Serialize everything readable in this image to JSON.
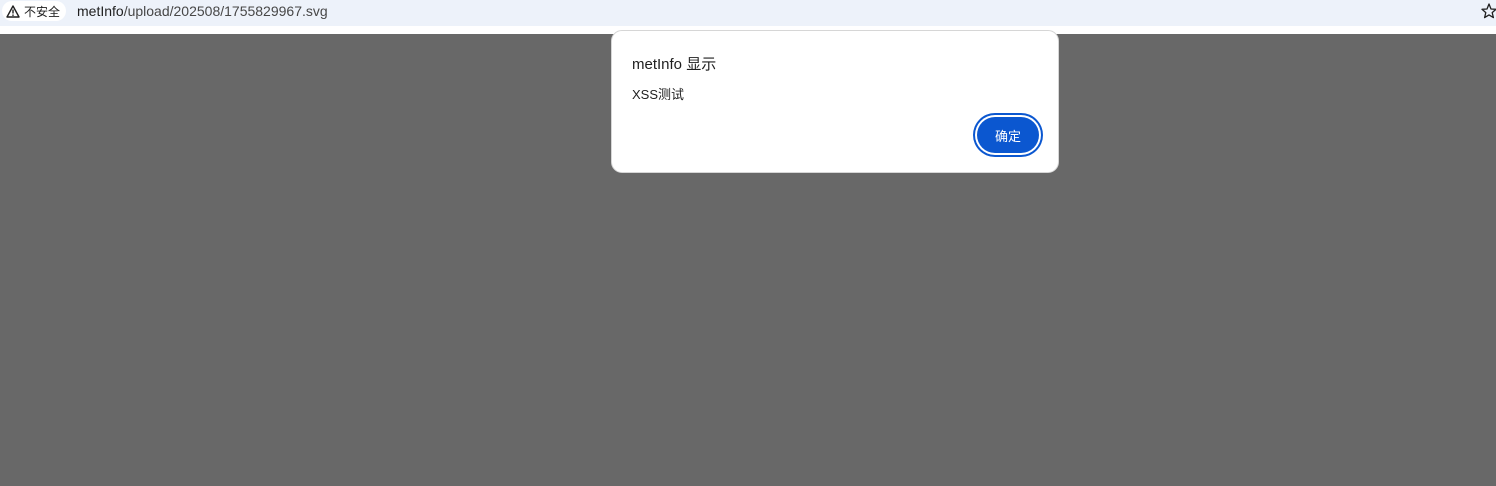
{
  "browser": {
    "security_label": "不安全",
    "url_host": "metInfo",
    "url_path": "/upload/202508/1755829967.svg"
  },
  "dialog": {
    "title": "metInfo 显示",
    "message": "XSS测试",
    "ok_label": "确定"
  },
  "colors": {
    "toolbar_background": "#edf2fa",
    "page_overlay": "#686868",
    "button_accent": "#0b57d0"
  }
}
